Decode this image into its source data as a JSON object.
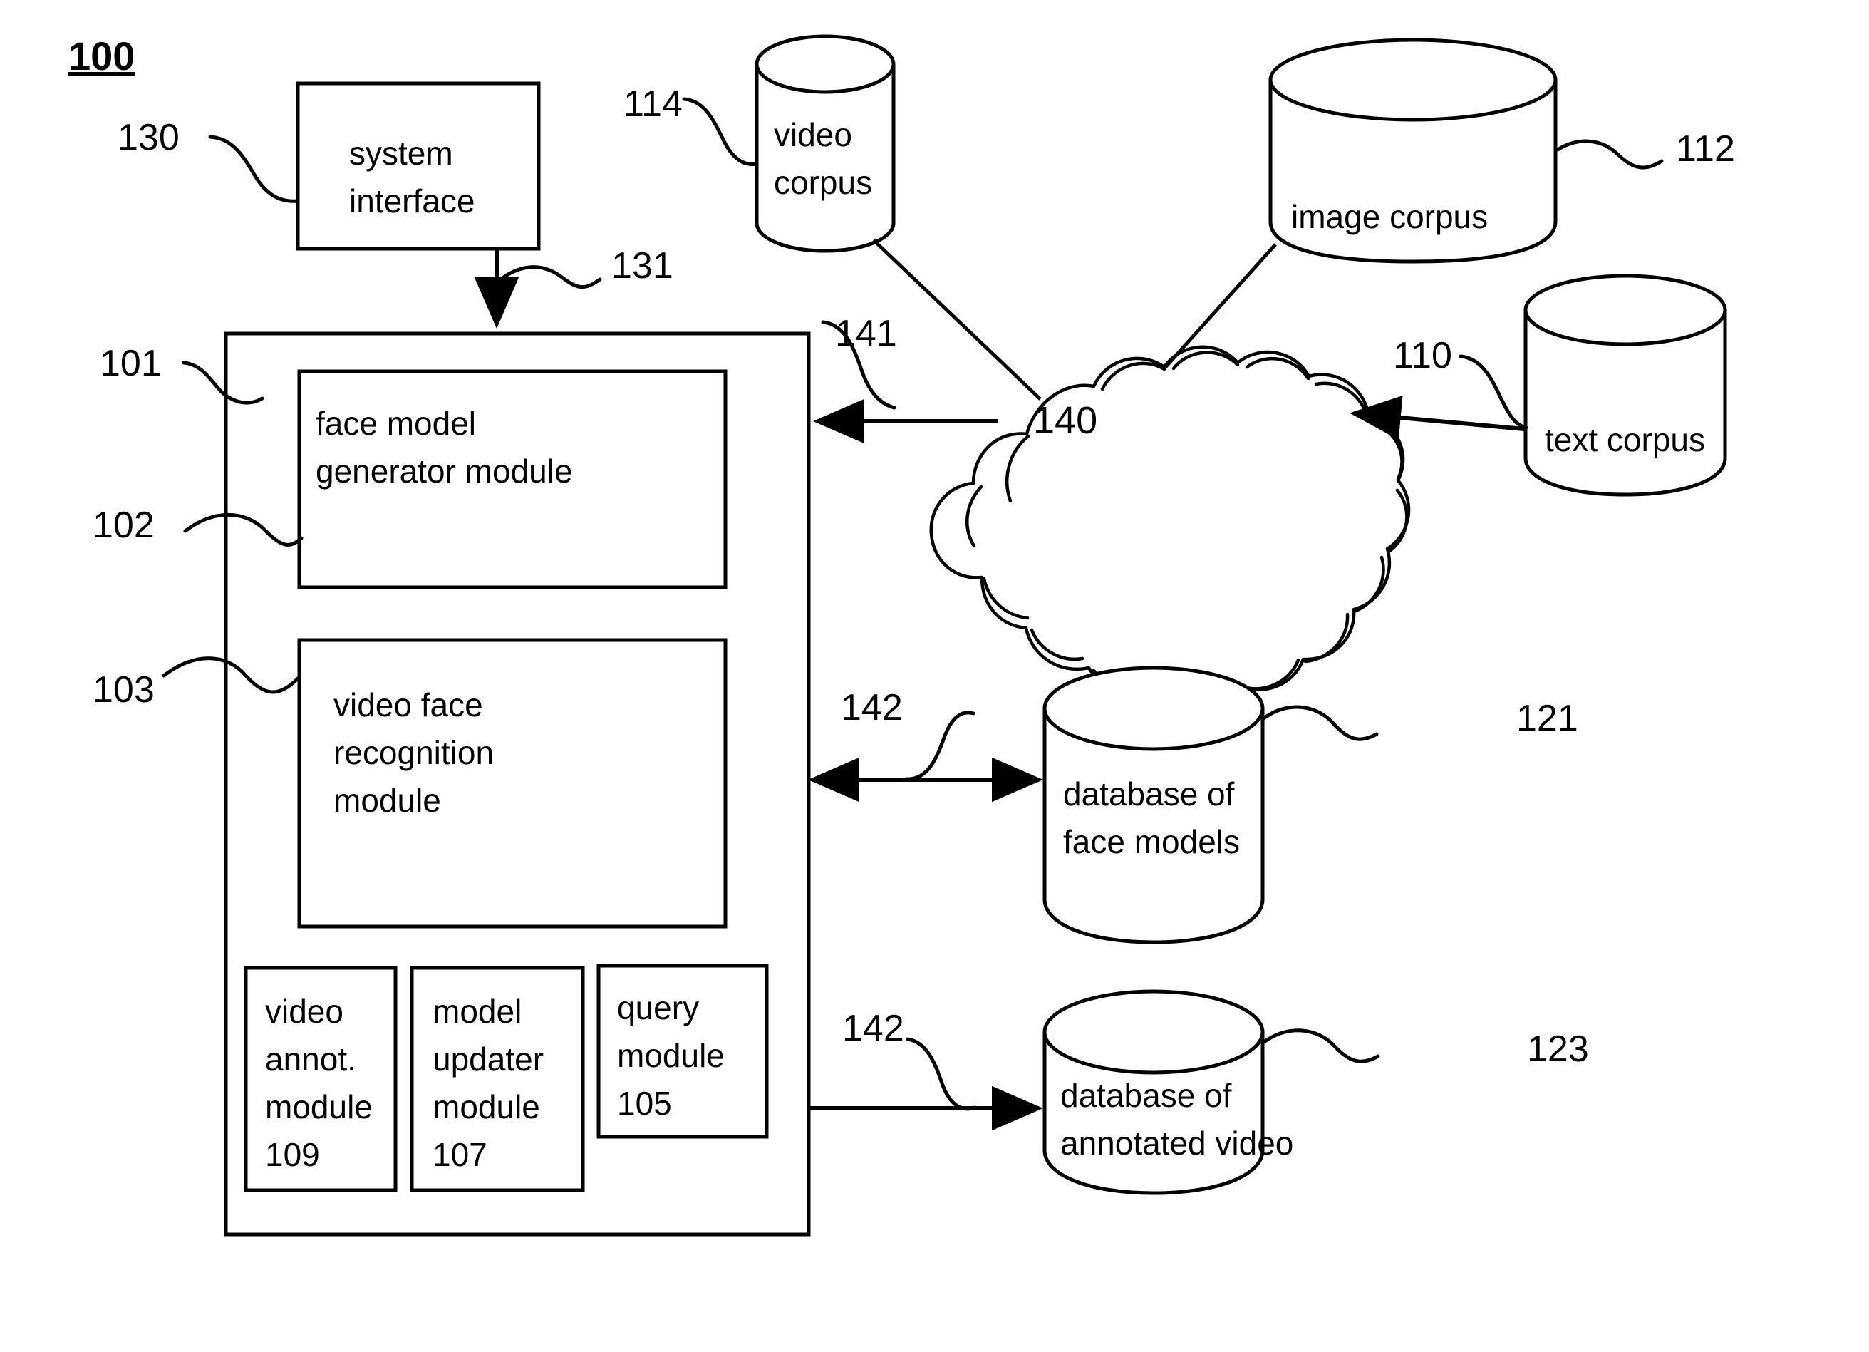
{
  "figure": {
    "number": "100",
    "title_ref": "100"
  },
  "boxes": {
    "system_interface": {
      "line1": "system",
      "line2": "interface",
      "ref": "130"
    },
    "face_model_generator": {
      "line1": "face model",
      "line2": "generator module",
      "ref": "102"
    },
    "video_face_recognition": {
      "line1": "video face",
      "line2": "recognition",
      "line3": "module",
      "ref": "103"
    },
    "video_annot_module": {
      "line1": "video",
      "line2": "annot.",
      "line3": "module",
      "line4": "109"
    },
    "model_updater_module": {
      "line1": "model",
      "line2": "updater",
      "line3": "module",
      "line4": "107"
    },
    "query_module": {
      "line1": "query",
      "line2": "module",
      "line3": "105"
    },
    "main_container": {
      "ref": "101"
    }
  },
  "cylinders": {
    "video_corpus": {
      "line1": "video",
      "line2": "corpus",
      "ref": "114"
    },
    "image_corpus": {
      "line1": "image corpus",
      "ref": "112"
    },
    "text_corpus": {
      "line1": "text corpus",
      "ref": "110"
    },
    "database_face_models": {
      "line1": "database of",
      "line2": "face models",
      "ref": "121"
    },
    "database_annotated_video": {
      "line1": "database of",
      "line2": "annotated video",
      "ref": "123"
    }
  },
  "cloud": {
    "label": "140",
    "ref": "141"
  },
  "connector_refs": {
    "interface_to_system": "131",
    "network_to_generator": "141",
    "recognition_to_face_db": "142",
    "query_to_video_db": "142"
  },
  "colors": {
    "stroke": "#000000",
    "background": "#ffffff"
  }
}
